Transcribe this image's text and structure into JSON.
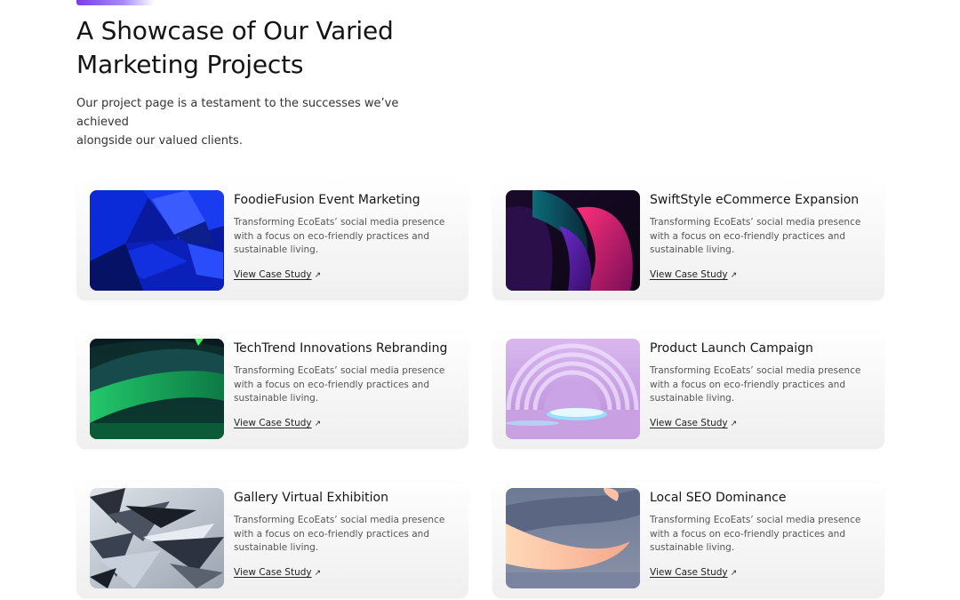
{
  "section": {
    "heading_lines": [
      "A Showcase of Our Varied",
      "Marketing Projects"
    ],
    "intro_lines": [
      "Our project page is a testament to the successes we’ve achieved",
      "alongside our valued clients."
    ],
    "accent_color": "#7c3aed"
  },
  "projects": [
    {
      "title": "FoodieFusion Event Marketing",
      "description_lines": [
        "Transforming EcoEats’ social media presence",
        "with a focus on eco-friendly practices and",
        "sustainable living."
      ],
      "link_label": "View Case Study",
      "link_icon": "↗",
      "image": "blue-3d-blocks"
    },
    {
      "title": "SwiftStyle eCommerce Expansion",
      "description_lines": [
        "Transforming EcoEats’ social media presence",
        "with a focus on eco-friendly practices and",
        "sustainable living."
      ],
      "link_label": "View Case Study",
      "link_icon": "↗",
      "image": "magenta-teal-swirl"
    },
    {
      "title": "TechTrend Innovations Rebranding",
      "description_lines": [
        "Transforming EcoEats’ social media presence",
        "with a focus on eco-friendly practices and",
        "sustainable living."
      ],
      "link_label": "View Case Study",
      "link_icon": "↗",
      "image": "green-wave"
    },
    {
      "title": "Product Launch Campaign",
      "description_lines": [
        "Transforming EcoEats’ social media presence",
        "with a focus on eco-friendly practices and",
        "sustainable living."
      ],
      "link_label": "View Case Study",
      "link_icon": "↗",
      "image": "lilac-arches-stage"
    },
    {
      "title": "Gallery Virtual Exhibition",
      "description_lines": [
        "Transforming EcoEats’ social media presence",
        "with a focus on eco-friendly practices and",
        "sustainable living."
      ],
      "link_label": "View Case Study",
      "link_icon": "↗",
      "image": "silver-shards"
    },
    {
      "title": "Local SEO Dominance",
      "description_lines": [
        "Transforming EcoEats’ social media presence",
        "with a focus on eco-friendly practices and",
        "sustainable living."
      ],
      "link_label": "View Case Study",
      "link_icon": "↗",
      "image": "peach-ribbon"
    }
  ]
}
